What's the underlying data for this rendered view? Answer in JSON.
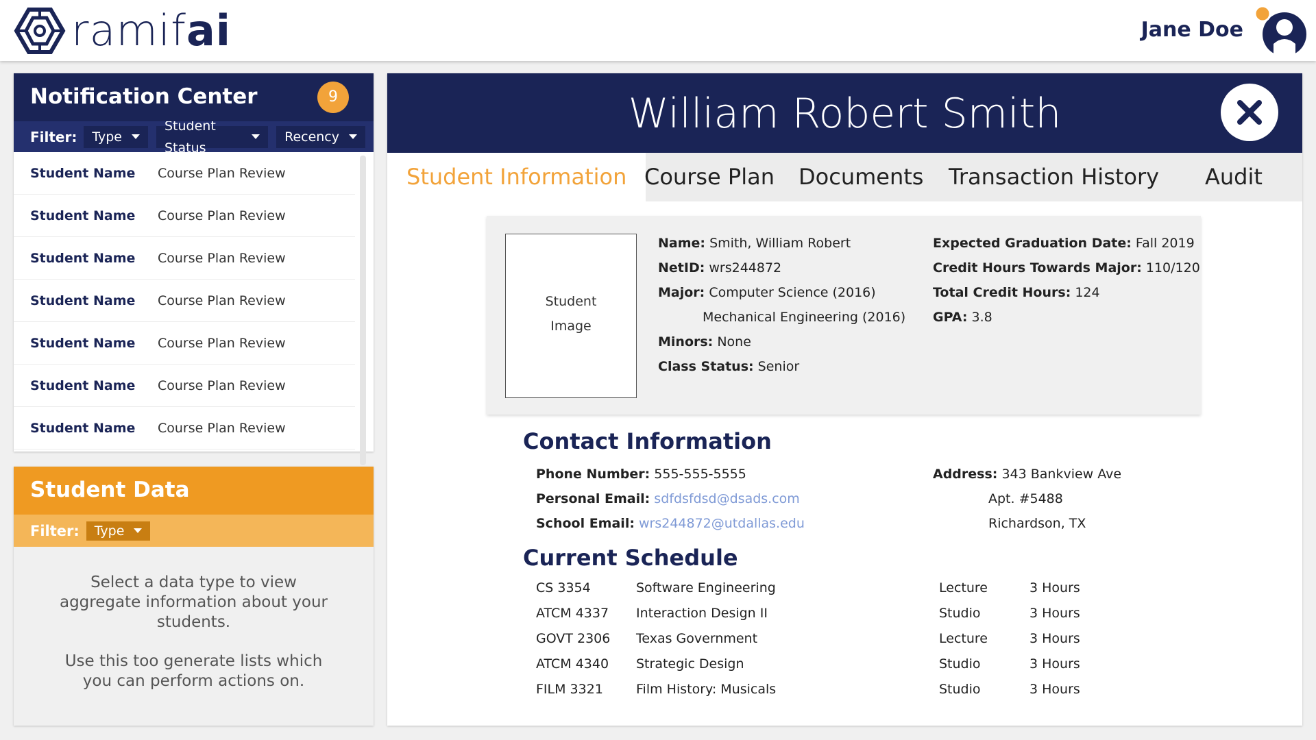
{
  "app": {
    "logo_text_light": "ramif",
    "logo_text_bold": "ai",
    "user_name": "Jane Doe",
    "colors": {
      "navy": "#1a2456",
      "orange": "#f2a33a",
      "link": "#7f9ad6"
    }
  },
  "notifications": {
    "title": "Notification Center",
    "badge_count": "9",
    "filter_label": "Filter:",
    "filters": [
      "Type",
      "Student Status",
      "Recency"
    ],
    "items": [
      {
        "name": "Student Name",
        "type": "Course Plan Review"
      },
      {
        "name": "Student Name",
        "type": "Course Plan Review"
      },
      {
        "name": "Student Name",
        "type": "Course Plan Review"
      },
      {
        "name": "Student Name",
        "type": "Course Plan Review"
      },
      {
        "name": "Student Name",
        "type": "Course Plan Review"
      },
      {
        "name": "Student Name",
        "type": "Course Plan Review"
      },
      {
        "name": "Student Name",
        "type": "Course Plan Review"
      }
    ]
  },
  "student_data": {
    "title": "Student Data",
    "filter_label": "Filter:",
    "filter_type": "Type",
    "text1": "Select a data type to view aggregate information about your students.",
    "text2": "Use this too generate lists which you can perform actions on."
  },
  "student": {
    "full_name": "William Robert Smith",
    "tabs": [
      "Student Information",
      "Course Plan",
      "Documents",
      "Transaction History",
      "Audit"
    ],
    "photo_label_1": "Student",
    "photo_label_2": "Image",
    "info": {
      "name_label": "Name:",
      "name": "Smith, William Robert",
      "netid_label": "NetID:",
      "netid": "wrs244872",
      "major_label": "Major:",
      "major1": "Computer Science (2016)",
      "major2": "Mechanical Engineering (2016)",
      "minors_label": "Minors:",
      "minors": "None",
      "class_label": "Class Status:",
      "class_status": "Senior",
      "grad_label": "Expected Graduation Date:",
      "grad": "Fall 2019",
      "credit_major_label": "Credit Hours Towards Major:",
      "credit_major": "110/120",
      "total_credit_label": "Total Credit Hours:",
      "total_credit": "124",
      "gpa_label": "GPA:",
      "gpa": "3.8"
    },
    "contact": {
      "title": "Contact Information",
      "phone_label": "Phone Number:",
      "phone": "555-555-5555",
      "personal_email_label": "Personal Email:",
      "personal_email": "sdfdsfdsd@dsads.com",
      "school_email_label": "School Email:",
      "school_email": "wrs244872@utdallas.edu",
      "address_label": "Address:",
      "address1": "343 Bankview Ave",
      "address2": "Apt. #5488",
      "address3": "Richardson, TX"
    },
    "schedule": {
      "title": "Current Schedule",
      "rows": [
        {
          "code": "CS 3354",
          "course": "Software Engineering",
          "kind": "Lecture",
          "hours": "3 Hours"
        },
        {
          "code": "ATCM 4337",
          "course": "Interaction Design II",
          "kind": "Studio",
          "hours": "3 Hours"
        },
        {
          "code": "GOVT 2306",
          "course": "Texas Government",
          "kind": "Lecture",
          "hours": "3 Hours"
        },
        {
          "code": "ATCM 4340",
          "course": "Strategic Design",
          "kind": "Studio",
          "hours": "3 Hours"
        },
        {
          "code": "FILM 3321",
          "course": "Film History: Musicals",
          "kind": "Studio",
          "hours": "3 Hours"
        }
      ]
    }
  }
}
